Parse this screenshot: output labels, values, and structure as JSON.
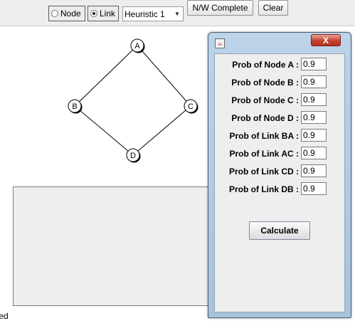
{
  "toolbar": {
    "node_label": "Node",
    "link_label": "Link",
    "node_selected": false,
    "link_selected": true,
    "heuristic_value": "Heuristic 1",
    "complete_button": "N/W Complete",
    "clear_button": "Clear"
  },
  "graph": {
    "nodes": [
      "A",
      "B",
      "C",
      "D"
    ],
    "links": [
      [
        "A",
        "B"
      ],
      [
        "A",
        "C"
      ],
      [
        "B",
        "D"
      ],
      [
        "C",
        "D"
      ]
    ]
  },
  "status_text": "rted",
  "dialog": {
    "close_symbol": "X",
    "rows": [
      {
        "label": "Prob of Node A :",
        "value": "0.9"
      },
      {
        "label": "Prob of Node B :",
        "value": "0.9"
      },
      {
        "label": "Prob of Node C :",
        "value": "0.9"
      },
      {
        "label": "Prob of Node D :",
        "value": "0.9"
      },
      {
        "label": "Prob of Link BA :",
        "value": "0.9"
      },
      {
        "label": "Prob of Link AC :",
        "value": "0.9"
      },
      {
        "label": "Prob of Link CD :",
        "value": "0.9"
      },
      {
        "label": "Prob of Link DB :",
        "value": "0.9"
      }
    ],
    "calculate_button": "Calculate"
  },
  "colors": {
    "dialog_frame": "#b3cbe3",
    "close_button": "#c6402c"
  }
}
